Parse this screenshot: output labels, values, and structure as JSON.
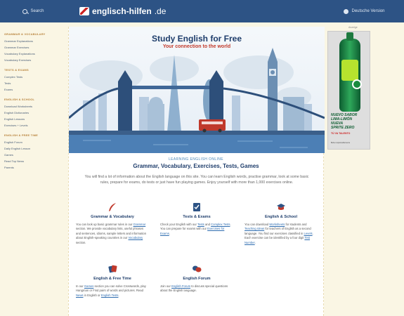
{
  "topbar": {
    "search_label": "Search",
    "logo_text": "englisch-hilfen",
    "logo_domain": ".de",
    "language_label": "Deutsche Version"
  },
  "sidebar": {
    "sections": [
      {
        "heading": "GRAMMAR & VOCABULARY",
        "items": [
          "Grammar Explanations",
          "Grammar Exercises",
          "Vocabulary Explanations",
          "Vocabulary Exercises"
        ]
      },
      {
        "heading": "TESTS & EXAMS",
        "items": [
          "Complex Tests",
          "Tests",
          "Exams"
        ]
      },
      {
        "heading": "ENGLISH & SCHOOL",
        "items": [
          "Download Worksheets",
          "English Dictionaries",
          "English Lessons",
          "Exercises + Levels"
        ]
      },
      {
        "heading": "ENGLISH & FREE TIME",
        "items": [
          "English Forum",
          "Daily English Lesson",
          "Games",
          "Read Top News",
          "Parents"
        ]
      }
    ]
  },
  "hero": {
    "title": "Study English for Free",
    "subtitle": "Your connection to the world"
  },
  "intro": {
    "small": "LEARNING ENGLISH ONLINE",
    "heading": "Grammar, Vocabulary, Exercises, Tests, Games",
    "text": "You will find a lot of information about the English language on this site. You can learn English words, practise grammar, look at some basic rules, prepare for exams, do tests or just have fun playing games. Enjoy yourself with more than 1,000 exercises online."
  },
  "cards": {
    "grammar": {
      "title": "Grammar & Vocabulary",
      "t1": "You can look up basic grammar rules in our ",
      "l1": "Grammar",
      "t2": " section. We provide vocabulary lists, useful phrases and sentences, idioms, sample letters and information about English-speaking countries in our ",
      "l2": "Vocabulary",
      "t3": " section."
    },
    "tests": {
      "title": "Tests & Exams",
      "t1": "Check your English with our ",
      "l1": "Tests",
      "t2": " and ",
      "l2": "Complex Tests",
      "t3": ". You can prepare for exams with our ",
      "l3": "Exercises for Exams",
      "t4": "."
    },
    "school": {
      "title": "English & School",
      "t1": "You can download ",
      "l1": "Worksheets",
      "t2": " for students and ",
      "l2": "Teaching Ideas",
      "t3": " for teachers of English as a second language. You find our exercises classified in ",
      "l3": "Levels",
      "t4": ". Each exercise can be identified by a four digit ",
      "l4": "Test Number",
      "t5": "."
    },
    "freetime": {
      "title": "English & Free Time",
      "t1": "In our ",
      "l1": "Games",
      "t2": " section you can solve Crosswords, play Hangman or Find pairs of words and pictures. Read ",
      "l2": "News",
      "t3": " in English or ",
      "l3": "English Tests",
      "t4": "."
    },
    "forum": {
      "title": "English Forum",
      "t1": "Join our ",
      "l1": "English Forum",
      "t2": " to discuss special questions about the English language."
    }
  },
  "ad": {
    "label": "Anzeige",
    "text_lines": [
      "NUEVO SABOR",
      "LIMA-LIMÓN",
      "NUEVA",
      "SPRITE ZERO"
    ],
    "claim": "TÚ VA TALENTO",
    "small": "Bebe responsablemente"
  },
  "colors": {
    "topbar": "#2d5385",
    "page_background": "#faf6e4",
    "sidebar_heading": "#b9853f",
    "link": "#2f6db0",
    "title": "#1e3d6b",
    "accent_red": "#c23b2c"
  },
  "icons": {
    "grammar": "feather-pen-icon",
    "tests": "checklist-icon",
    "school": "graduation-cap-icon",
    "freetime": "playing-cards-icon",
    "forum": "speech-bubbles-icon"
  }
}
